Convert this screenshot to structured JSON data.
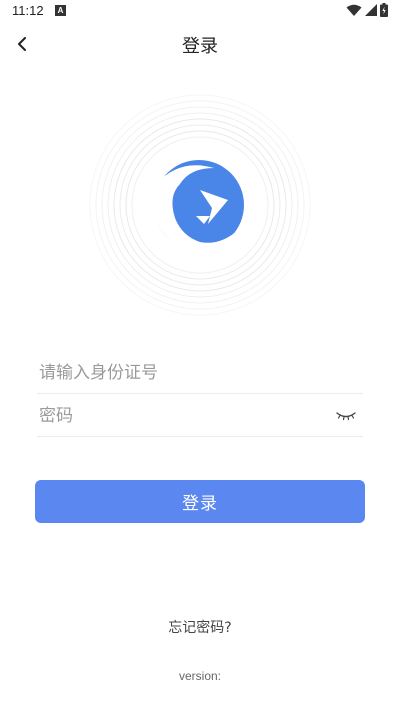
{
  "status_bar": {
    "time": "11:12",
    "notification_letter": "A",
    "icons": [
      "wifi-icon",
      "signal-icon",
      "battery-icon"
    ]
  },
  "nav": {
    "title": "登录",
    "back_icon": "chevron-left-icon"
  },
  "logo": {
    "icon": "app-logo-icon",
    "primary_color": "#4a86e8",
    "ring_color": "#e6e6e6"
  },
  "form": {
    "id_placeholder": "请输入身份证号",
    "id_value": "",
    "password_placeholder": "密码",
    "password_value": "",
    "eye_icon": "eye-closed-icon"
  },
  "login_button": {
    "label": "登录",
    "color": "#5b87f0"
  },
  "forgot_password": "忘记密码?",
  "version": "version:"
}
